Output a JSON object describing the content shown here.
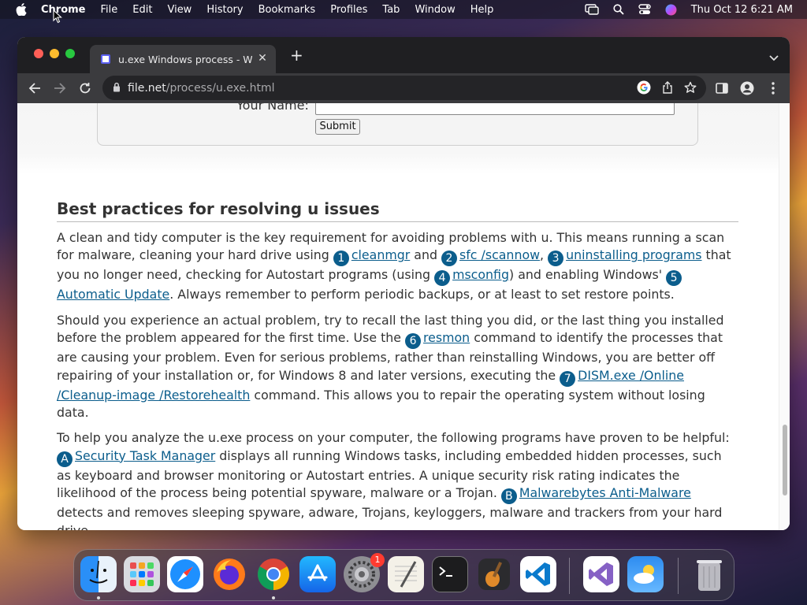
{
  "menubar": {
    "app_name": "Chrome",
    "items": [
      "File",
      "Edit",
      "View",
      "History",
      "Bookmarks",
      "Profiles",
      "Tab",
      "Window",
      "Help"
    ],
    "clock": "Thu Oct 12  6:21 AM"
  },
  "browser": {
    "tab_title": "u.exe Windows process - Wha",
    "url_host": "file.net",
    "url_path": "/process/u.exe.html"
  },
  "form": {
    "name_label": "Your Name:",
    "submit_label": "Submit"
  },
  "article": {
    "heading": "Best practices for resolving u issues",
    "p1": {
      "t1": "A clean and tidy computer is the key requirement for avoiding problems with u. This means running a scan for malware, cleaning your hard drive using ",
      "b1": "1",
      "l1": "cleanmgr",
      "t2": " and ",
      "b2": "2",
      "l2": "sfc /scannow",
      "t3": ", ",
      "b3": "3",
      "l3": "uninstalling programs",
      "t4": " that you no longer need, checking for Autostart programs (using ",
      "b4": "4",
      "l4": "msconfig",
      "t5": ") and enabling Windows' ",
      "b5": "5",
      "l5": "Automatic Update",
      "t6": ". Always remember to perform periodic backups, or at least to set restore points."
    },
    "p2": {
      "t1": "Should you experience an actual problem, try to recall the last thing you did, or the last thing you installed before the problem appeared for the first time. Use the ",
      "b6": "6",
      "l6": "resmon",
      "t2": " command to identify the processes that are causing your problem. Even for serious problems, rather than reinstalling Windows, you are better off repairing of your installation or, for Windows 8 and later versions, executing the ",
      "b7": "7",
      "l7": "DISM.exe /Online /Cleanup-image /Restorehealth",
      "t3": " command. This allows you to repair the operating system without losing data."
    },
    "p3": {
      "t1": "To help you analyze the u.exe process on your computer, the following programs have proven to be helpful: ",
      "bA": "A",
      "lA": "Security Task Manager",
      "t2": " displays all running Windows tasks, including embedded hidden processes, such as keyboard and browser monitoring or Autostart entries. A unique security risk rating indicates the likelihood of the process being potential spyware, malware or a Trojan. ",
      "bB": "B",
      "lB": "Malwarebytes Anti-Malware",
      "t3": " detects and removes sleeping spyware, adware, Trojans, keyloggers, malware and trackers from your hard drive."
    }
  },
  "dock": {
    "apps": [
      "finder",
      "launchpad",
      "safari",
      "firefox",
      "chrome",
      "app-store",
      "system-settings",
      "textedit",
      "terminal",
      "garageband",
      "vscode",
      "visual-studio",
      "weather",
      "trash"
    ],
    "settings_badge": "1"
  },
  "colors": {
    "link": "#0b5d8c",
    "badge": "#0b5d8c",
    "tab_bar": "#1f1f22",
    "toolbar": "#3b3b3e"
  }
}
